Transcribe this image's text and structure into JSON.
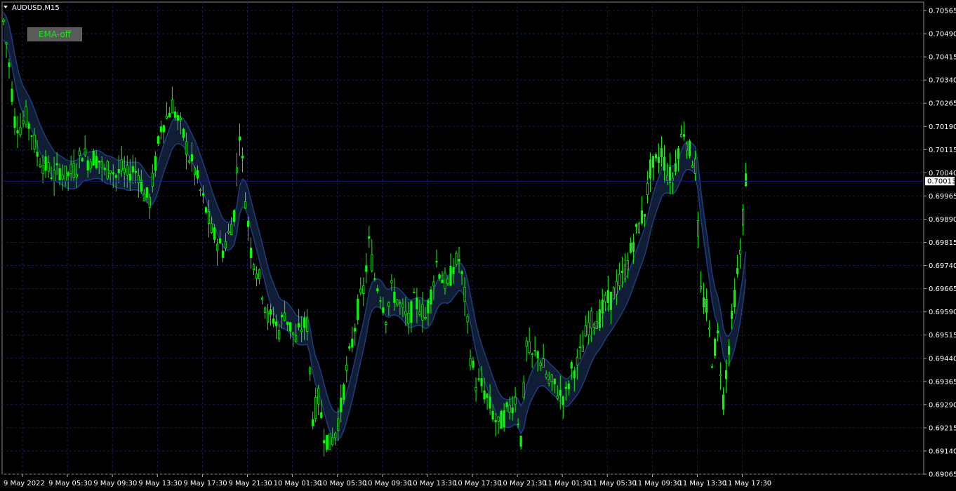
{
  "header": {
    "symbol_label": "AUDUSD,M15"
  },
  "ema_button": {
    "label": "EMA-off"
  },
  "colors": {
    "background": "#000000",
    "grid": "#17176e",
    "bull": "#00ff00",
    "bear": "#00ff00",
    "band_fill": "#13203a",
    "band_line": "#1c3d80",
    "axis_text": "#ffffff",
    "current_price_line": "#1a1a8c"
  },
  "chart_data": {
    "type": "candlestick",
    "symbol": "AUDUSD",
    "timeframe": "M15",
    "current_price": "0.70013",
    "ylim": [
      0.69065,
      0.7059
    ],
    "y_ticks": [
      "0.70565",
      "0.70490",
      "0.70415",
      "0.70340",
      "0.70265",
      "0.70190",
      "0.70115",
      "0.70040",
      "0.69965",
      "0.69890",
      "0.69815",
      "0.69740",
      "0.69665",
      "0.69590",
      "0.69515",
      "0.69440",
      "0.69365",
      "0.69290",
      "0.69215",
      "0.69140",
      "0.69065"
    ],
    "x_ticks": [
      "9 May 2022",
      "9 May 05:30",
      "9 May 09:30",
      "9 May 13:30",
      "9 May 17:30",
      "9 May 21:30",
      "10 May 01:30",
      "10 May 05:30",
      "10 May 09:30",
      "10 May 13:30",
      "10 May 17:30",
      "10 May 21:30",
      "11 May 01:30",
      "11 May 05:30",
      "11 May 09:30",
      "11 May 13:30",
      "11 May 17:30"
    ],
    "bars_per_tick": 16,
    "price_path": [
      [
        0,
        0.7053
      ],
      [
        1,
        0.7046
      ],
      [
        2,
        0.7039
      ],
      [
        4,
        0.7021
      ],
      [
        6,
        0.7019
      ],
      [
        8,
        0.7022
      ],
      [
        10,
        0.7017
      ],
      [
        12,
        0.701
      ],
      [
        14,
        0.7007
      ],
      [
        16,
        0.7005
      ],
      [
        18,
        0.7003
      ],
      [
        20,
        0.7005
      ],
      [
        22,
        0.7003
      ],
      [
        24,
        0.7004
      ],
      [
        26,
        0.7006
      ],
      [
        28,
        0.7011
      ],
      [
        30,
        0.7008
      ],
      [
        32,
        0.7009
      ],
      [
        34,
        0.7008
      ],
      [
        36,
        0.7004
      ],
      [
        38,
        0.7006
      ],
      [
        40,
        0.7003
      ],
      [
        42,
        0.7005
      ],
      [
        44,
        0.7003
      ],
      [
        46,
        0.7005
      ],
      [
        48,
        0.7004
      ],
      [
        50,
        0.6997
      ],
      [
        52,
        0.6995
      ],
      [
        54,
        0.7007
      ],
      [
        56,
        0.7019
      ],
      [
        58,
        0.7022
      ],
      [
        60,
        0.7026
      ],
      [
        62,
        0.7021
      ],
      [
        64,
        0.7016
      ],
      [
        66,
        0.7009
      ],
      [
        68,
        0.7005
      ],
      [
        70,
        0.6998
      ],
      [
        72,
        0.6992
      ],
      [
        74,
        0.6985
      ],
      [
        76,
        0.6982
      ],
      [
        78,
        0.6979
      ],
      [
        80,
        0.6984
      ],
      [
        82,
        0.6991
      ],
      [
        84,
        0.7018
      ],
      [
        86,
        0.6996
      ],
      [
        88,
        0.6979
      ],
      [
        90,
        0.6973
      ],
      [
        92,
        0.6966
      ],
      [
        94,
        0.6957
      ],
      [
        96,
        0.6957
      ],
      [
        98,
        0.6953
      ],
      [
        100,
        0.6959
      ],
      [
        102,
        0.6954
      ],
      [
        104,
        0.695
      ],
      [
        106,
        0.6954
      ],
      [
        108,
        0.6955
      ],
      [
        110,
        0.6925
      ],
      [
        112,
        0.6931
      ],
      [
        114,
        0.692
      ],
      [
        116,
        0.6916
      ],
      [
        118,
        0.692
      ],
      [
        120,
        0.6928
      ],
      [
        122,
        0.694
      ],
      [
        124,
        0.6949
      ],
      [
        126,
        0.696
      ],
      [
        128,
        0.6966
      ],
      [
        130,
        0.6981
      ],
      [
        132,
        0.697
      ],
      [
        134,
        0.6965
      ],
      [
        136,
        0.6958
      ],
      [
        138,
        0.6966
      ],
      [
        140,
        0.6963
      ],
      [
        142,
        0.6959
      ],
      [
        144,
        0.6956
      ],
      [
        146,
        0.6962
      ],
      [
        148,
        0.6961
      ],
      [
        150,
        0.6957
      ],
      [
        152,
        0.6965
      ],
      [
        154,
        0.6975
      ],
      [
        156,
        0.697
      ],
      [
        158,
        0.6967
      ],
      [
        160,
        0.6974
      ],
      [
        162,
        0.6976
      ],
      [
        164,
        0.6964
      ],
      [
        166,
        0.6945
      ],
      [
        168,
        0.6936
      ],
      [
        170,
        0.6935
      ],
      [
        172,
        0.6931
      ],
      [
        174,
        0.6926
      ],
      [
        176,
        0.6922
      ],
      [
        178,
        0.6925
      ],
      [
        180,
        0.6928
      ],
      [
        182,
        0.6931
      ],
      [
        184,
        0.6918
      ],
      [
        186,
        0.6948
      ],
      [
        188,
        0.6944
      ],
      [
        190,
        0.6946
      ],
      [
        192,
        0.6941
      ],
      [
        194,
        0.6936
      ],
      [
        196,
        0.6935
      ],
      [
        198,
        0.6932
      ],
      [
        200,
        0.6932
      ],
      [
        202,
        0.694
      ],
      [
        204,
        0.6942
      ],
      [
        206,
        0.6948
      ],
      [
        208,
        0.6955
      ],
      [
        210,
        0.6957
      ],
      [
        212,
        0.6957
      ],
      [
        214,
        0.6962
      ],
      [
        216,
        0.6963
      ],
      [
        218,
        0.6967
      ],
      [
        220,
        0.697
      ],
      [
        222,
        0.6975
      ],
      [
        224,
        0.6982
      ],
      [
        226,
        0.6987
      ],
      [
        228,
        0.6992
      ],
      [
        230,
        0.7005
      ],
      [
        232,
        0.7007
      ],
      [
        234,
        0.7011
      ],
      [
        236,
        0.7004
      ],
      [
        238,
        0.7002
      ],
      [
        240,
        0.7012
      ],
      [
        242,
        0.7018
      ],
      [
        244,
        0.7011
      ],
      [
        246,
        0.7006
      ],
      [
        248,
        0.6965
      ],
      [
        250,
        0.696
      ],
      [
        252,
        0.6944
      ],
      [
        254,
        0.6951
      ],
      [
        256,
        0.6931
      ],
      [
        258,
        0.6948
      ],
      [
        260,
        0.6964
      ],
      [
        262,
        0.6978
      ],
      [
        264,
        0.7002
      ]
    ],
    "band_offsets": [
      0.0003,
      0.0006
    ],
    "ema_lag_bars": 8
  }
}
